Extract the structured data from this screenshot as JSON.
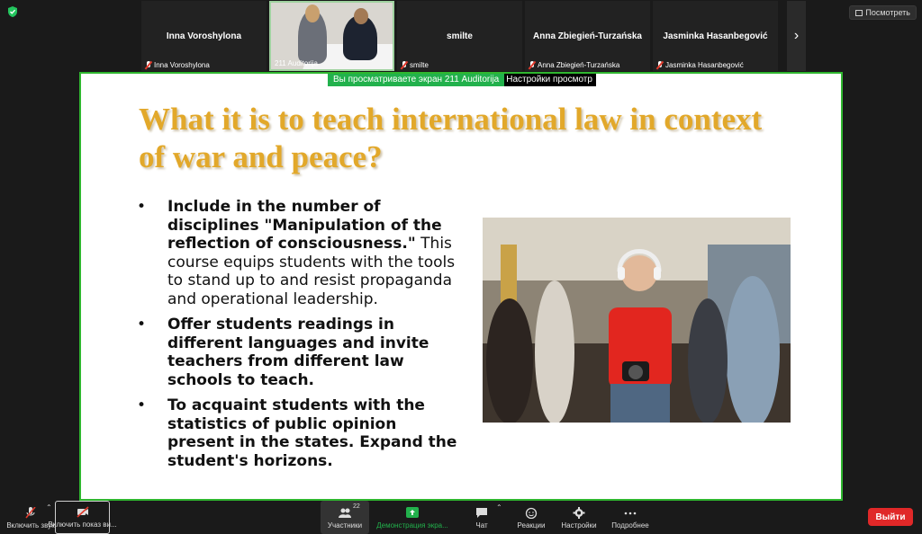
{
  "top_bar": {
    "view_button_label": "Посмотреть"
  },
  "participants": [
    {
      "display_name": "Inna Voroshylona",
      "label": "Inna Voroshylona",
      "muted": true,
      "video": false
    },
    {
      "display_name": "",
      "label": "211 Auditorija",
      "muted": false,
      "video": true
    },
    {
      "display_name": "smilte",
      "label": "smilte",
      "muted": true,
      "video": false
    },
    {
      "display_name": "Anna Zbiegień-Turzańska",
      "label": "Anna Zbiegień-Turzańska",
      "muted": true,
      "video": false
    },
    {
      "display_name": "Jasminka Hasanbegović",
      "label": "Jasminka Hasanbegović",
      "muted": true,
      "video": false
    }
  ],
  "share_notice": {
    "viewing_text": "Вы просматриваете экран 211 Auditorija",
    "view_options_label": "Настройки просмотр"
  },
  "slide": {
    "title": "What it is to teach international law in context of war and peace?",
    "bullets": [
      {
        "bold": "Include in the number of disciplines \"Manipulation of the reflection of consciousness.\"",
        "text": " This course equips students with the tools to stand up to and resist propaganda and operational leadership."
      },
      {
        "bold": "Offer students readings in different languages and invite teachers from different law schools to teach.",
        "text": ""
      },
      {
        "bold": "To acquaint students with the statistics of public opinion present in the states. Expand the student's horizons.",
        "text": ""
      }
    ]
  },
  "toolbar": {
    "unmute_label": "Включить звук",
    "start_video_label": "Включить показ ви...",
    "participants_label": "Участники",
    "participants_count": "22",
    "share_label": "Демонстрация экра...",
    "chat_label": "Чат",
    "reactions_label": "Реакции",
    "settings_label": "Настройки",
    "more_label": "Подробнее",
    "leave_label": "Выйти"
  },
  "colors": {
    "accent_green": "#22b14c",
    "title_gold": "#e2a82a",
    "leave_red": "#e02828"
  }
}
